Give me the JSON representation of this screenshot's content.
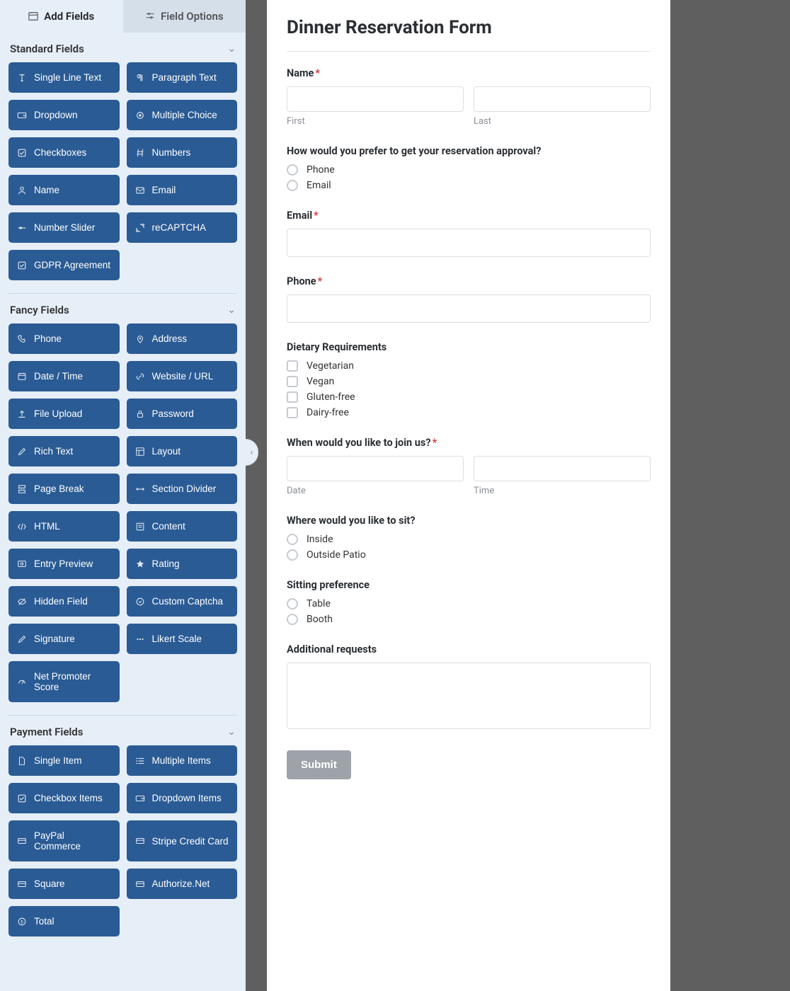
{
  "tabs": {
    "add_fields": "Add Fields",
    "field_options": "Field Options"
  },
  "sections": {
    "standard": {
      "title": "Standard Fields",
      "items": [
        {
          "label": "Single Line Text",
          "icon": "text-icon"
        },
        {
          "label": "Paragraph Text",
          "icon": "paragraph-icon"
        },
        {
          "label": "Dropdown",
          "icon": "dropdown-icon"
        },
        {
          "label": "Multiple Choice",
          "icon": "radio-icon"
        },
        {
          "label": "Checkboxes",
          "icon": "checkbox-icon"
        },
        {
          "label": "Numbers",
          "icon": "hash-icon"
        },
        {
          "label": "Name",
          "icon": "user-icon"
        },
        {
          "label": "Email",
          "icon": "mail-icon"
        },
        {
          "label": "Number Slider",
          "icon": "slider-icon"
        },
        {
          "label": "reCAPTCHA",
          "icon": "recaptcha-icon"
        },
        {
          "label": "GDPR Agreement",
          "icon": "check-icon"
        }
      ]
    },
    "fancy": {
      "title": "Fancy Fields",
      "items": [
        {
          "label": "Phone",
          "icon": "phone-icon"
        },
        {
          "label": "Address",
          "icon": "pin-icon"
        },
        {
          "label": "Date / Time",
          "icon": "calendar-icon"
        },
        {
          "label": "Website / URL",
          "icon": "link-icon"
        },
        {
          "label": "File Upload",
          "icon": "upload-icon"
        },
        {
          "label": "Password",
          "icon": "lock-icon"
        },
        {
          "label": "Rich Text",
          "icon": "pencil-icon"
        },
        {
          "label": "Layout",
          "icon": "layout-icon"
        },
        {
          "label": "Page Break",
          "icon": "pagebreak-icon"
        },
        {
          "label": "Section Divider",
          "icon": "divider-icon"
        },
        {
          "label": "HTML",
          "icon": "code-icon"
        },
        {
          "label": "Content",
          "icon": "content-icon"
        },
        {
          "label": "Entry Preview",
          "icon": "preview-icon"
        },
        {
          "label": "Rating",
          "icon": "star-icon"
        },
        {
          "label": "Hidden Field",
          "icon": "eye-off-icon"
        },
        {
          "label": "Custom Captcha",
          "icon": "captcha-icon"
        },
        {
          "label": "Signature",
          "icon": "signature-icon"
        },
        {
          "label": "Likert Scale",
          "icon": "likert-icon"
        },
        {
          "label": "Net Promoter Score",
          "icon": "gauge-icon"
        }
      ]
    },
    "payment": {
      "title": "Payment Fields",
      "items": [
        {
          "label": "Single Item",
          "icon": "file-icon"
        },
        {
          "label": "Multiple Items",
          "icon": "list-icon"
        },
        {
          "label": "Checkbox Items",
          "icon": "check-icon"
        },
        {
          "label": "Dropdown Items",
          "icon": "dropdown-icon"
        },
        {
          "label": "PayPal Commerce",
          "icon": "card-icon"
        },
        {
          "label": "Stripe Credit Card",
          "icon": "card-icon"
        },
        {
          "label": "Square",
          "icon": "card-icon"
        },
        {
          "label": "Authorize.Net",
          "icon": "card-icon"
        },
        {
          "label": "Total",
          "icon": "total-icon"
        }
      ]
    }
  },
  "form": {
    "title": "Dinner Reservation Form",
    "name": {
      "label": "Name",
      "first": "First",
      "last": "Last"
    },
    "approval": {
      "label": "How would you prefer to get your reservation approval?",
      "options": [
        "Phone",
        "Email"
      ]
    },
    "email": {
      "label": "Email"
    },
    "phone": {
      "label": "Phone"
    },
    "dietary": {
      "label": "Dietary Requirements",
      "options": [
        "Vegetarian",
        "Vegan",
        "Gluten-free",
        "Dairy-free"
      ]
    },
    "when": {
      "label": "When would you like to join us?",
      "date": "Date",
      "time": "Time"
    },
    "where": {
      "label": "Where would you like to sit?",
      "options": [
        "Inside",
        "Outside Patio"
      ]
    },
    "sitting": {
      "label": "Sitting preference",
      "options": [
        "Table",
        "Booth"
      ]
    },
    "additional": {
      "label": "Additional requests"
    },
    "submit": "Submit"
  }
}
